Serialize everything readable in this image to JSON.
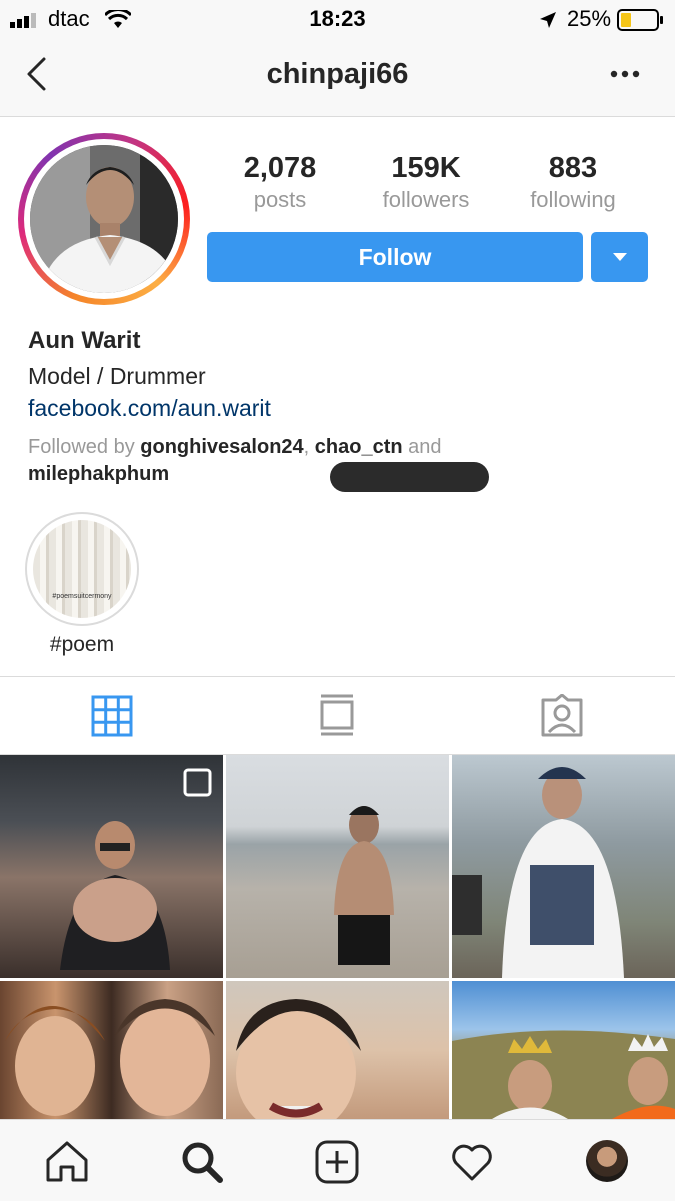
{
  "status_bar": {
    "carrier": "dtac",
    "time": "18:23",
    "battery": "25%"
  },
  "nav": {
    "title": "chinpaji66"
  },
  "profile": {
    "stats": [
      {
        "value": "2,078",
        "label": "posts"
      },
      {
        "value": "159K",
        "label": "followers"
      },
      {
        "value": "883",
        "label": "following"
      }
    ],
    "follow_label": "Follow",
    "name": "Aun Warit",
    "bio": "Model / Drummer",
    "link": "facebook.com/aun.warit",
    "followed_prefix": "Followed by ",
    "followed_user1": "gonghivesalon24",
    "followed_sep": ", ",
    "followed_user2": "chao_ctn",
    "followed_and": " and",
    "followed_user3": "milephakphum"
  },
  "highlight": {
    "thumb_text": "#poemsuitcermony",
    "label": "#poem"
  },
  "tabs": [
    "grid-icon",
    "feed-icon",
    "tagged-icon"
  ],
  "colors": {
    "accent": "#3897f0",
    "link": "#003569",
    "muted": "#999999",
    "text": "#262626"
  }
}
